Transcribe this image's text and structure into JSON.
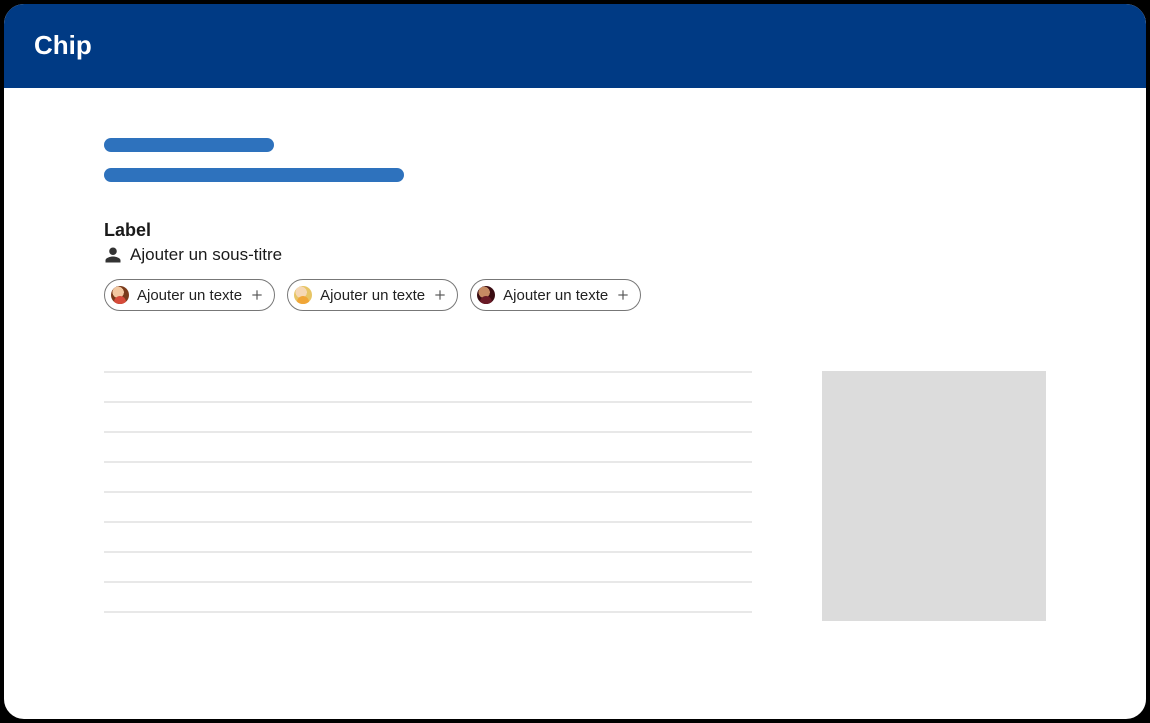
{
  "header": {
    "title": "Chip"
  },
  "form": {
    "label": "Label",
    "subtitle": "Ajouter un sous-titre"
  },
  "chips": [
    {
      "label": "Ajouter un texte",
      "avatar": "av1"
    },
    {
      "label": "Ajouter un texte",
      "avatar": "av2"
    },
    {
      "label": "Ajouter un texte",
      "avatar": "av3"
    }
  ],
  "icons": {
    "person": "person-icon",
    "plus": "plus-icon"
  }
}
